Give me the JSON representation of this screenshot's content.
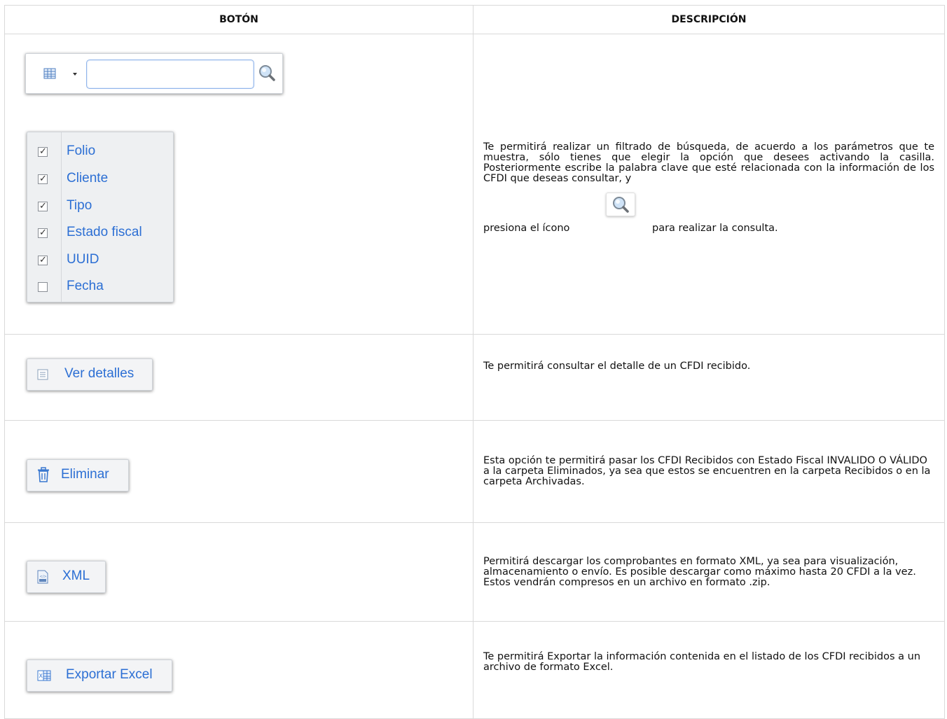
{
  "headers": {
    "button": "BOTÓN",
    "description": "DESCRIPCIÓN"
  },
  "rows": [
    {
      "search": {
        "input_value": ""
      },
      "checklist": [
        {
          "label": "Folio",
          "checked": true
        },
        {
          "label": "Cliente",
          "checked": true
        },
        {
          "label": "Tipo",
          "checked": true
        },
        {
          "label": "Estado fiscal",
          "checked": true
        },
        {
          "label": "UUID",
          "checked": true
        },
        {
          "label": "Fecha",
          "checked": false
        }
      ],
      "description_main": "Te permitirá realizar un filtrado de búsqueda, de acuerdo a los parámetros que te muestra, sólo tienes que elegir la opción que desees activando la casilla. Posteriormente escribe  la palabra clave que esté relacionada  con la información de los CFDI que deseas consultar, y",
      "description_before_icon": "presiona el ícono",
      "description_after_icon": "para realizar la consulta.",
      "icon": "magnifier-icon"
    },
    {
      "button_label": "Ver detalles",
      "icon": "details-list-icon",
      "description": "Te permitirá consultar el detalle de un CFDI recibido."
    },
    {
      "button_label": "Eliminar",
      "icon": "trash-icon",
      "description": "Esta opción te permitirá pasar los CFDI Recibidos con Estado Fiscal INVALIDO O VÁLIDO a la carpeta Eliminados, ya sea que estos se encuentren en la carpeta Recibidos o en la carpeta Archivadas."
    },
    {
      "button_label": "XML",
      "icon": "xml-file-icon",
      "description": "Permitirá descargar los comprobantes en formato XML, ya sea para visualización, almacenamiento o envío. Es posible descargar como máximo hasta 20 CFDI a la vez. Estos vendrán compresos en un archivo en formato .zip."
    },
    {
      "button_label": "Exportar Excel",
      "icon": "excel-icon",
      "description": "Te permitirá Exportar la información contenida en el listado de los CFDI recibidos a un archivo de formato Excel."
    }
  ],
  "colors": {
    "link_blue": "#2c6fd4",
    "border": "#d9d9d9"
  }
}
